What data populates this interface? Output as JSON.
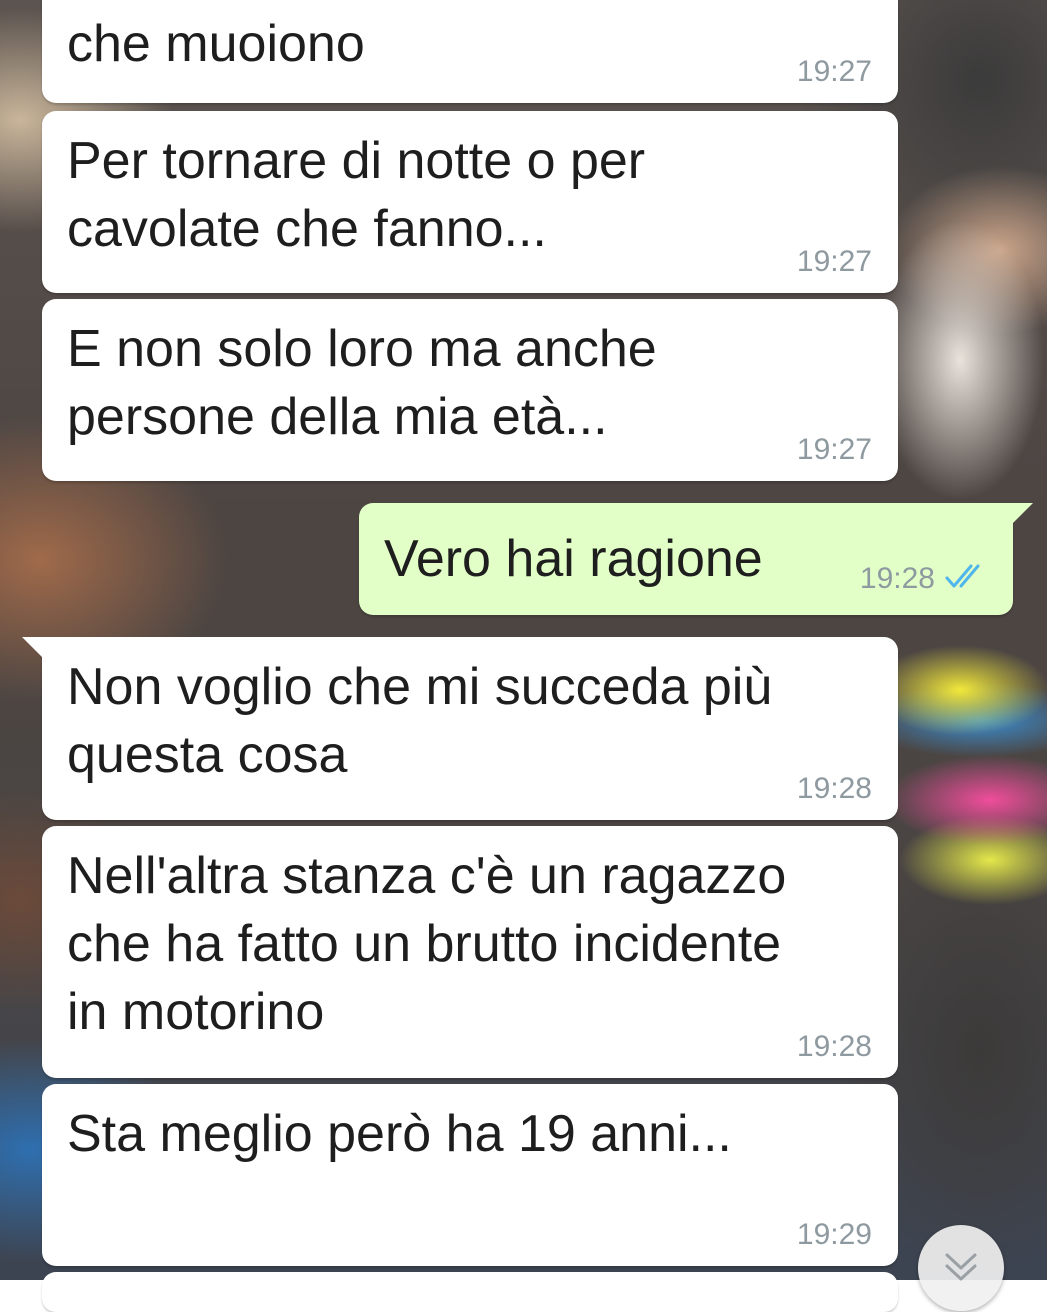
{
  "messages": [
    {
      "direction": "incoming",
      "text": "che muoiono",
      "time": "19:27"
    },
    {
      "direction": "incoming",
      "text": "Per tornare di notte o per\ncavolate che fanno...",
      "time": "19:27"
    },
    {
      "direction": "incoming",
      "text": "E non solo loro ma anche\npersone della mia età...",
      "time": "19:27"
    },
    {
      "direction": "outgoing",
      "text": "Vero hai ragione",
      "time": "19:28",
      "status": "read-double-check-icon"
    },
    {
      "direction": "incoming",
      "text": "Non voglio che mi succeda più\nquesta cosa",
      "time": "19:28"
    },
    {
      "direction": "incoming",
      "text": "Nell'altra stanza c'è un ragazzo\nche ha fatto un brutto incidente\nin motorino",
      "time": "19:28"
    },
    {
      "direction": "incoming",
      "text": "Sta meglio però ha 19 anni...",
      "time": "19:29"
    }
  ],
  "colors": {
    "incoming_bubble": "#ffffff",
    "outgoing_bubble": "#e2ffc7",
    "text": "#1e1e1e",
    "timestamp": "#8e9aa0",
    "read_ticks": "#4fb6ec"
  },
  "icons": {
    "scroll_down": "double-chevron-down-icon"
  }
}
